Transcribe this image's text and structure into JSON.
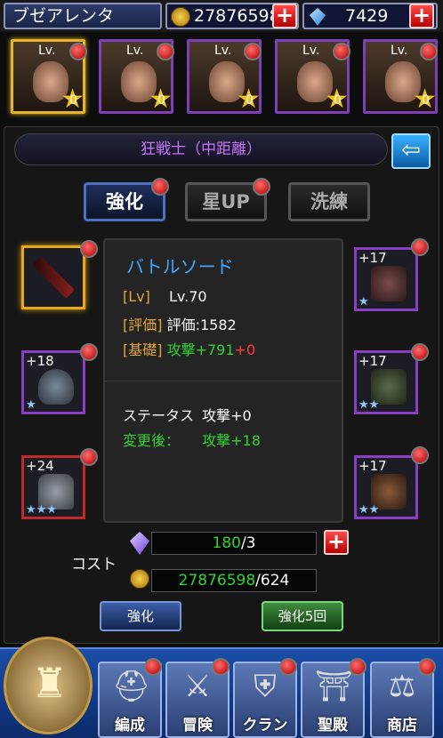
{
  "topbar": {
    "player_name": "ブゼアレンタ",
    "gold": "27876598",
    "gems": "7429",
    "add_gold_label": "+",
    "add_gems_label": "+"
  },
  "heroes": [
    {
      "lv": "Lv.",
      "count": "0",
      "selected": true
    },
    {
      "lv": "Lv.",
      "count": "0",
      "selected": false
    },
    {
      "lv": "Lv.",
      "count": "0",
      "selected": false
    },
    {
      "lv": "Lv.",
      "count": "0",
      "selected": false
    },
    {
      "lv": "Lv.",
      "count": "0",
      "selected": false
    }
  ],
  "class_name": "狂戦士（中距離）",
  "tabs": [
    "強化",
    "星UP",
    "洗練"
  ],
  "equipment": {
    "left": [
      {
        "plus": "",
        "stars": "",
        "border": "gold"
      },
      {
        "plus": "+18",
        "stars": "★",
        "border": "purple"
      },
      {
        "plus": "+24",
        "stars": "★★★",
        "border": "red"
      }
    ],
    "right": [
      {
        "plus": "+17",
        "stars": "★",
        "border": "purple"
      },
      {
        "plus": "+17",
        "stars": "★★",
        "border": "purple"
      },
      {
        "plus": "+17",
        "stars": "★★",
        "border": "purple"
      }
    ]
  },
  "item": {
    "name": "バトルソード",
    "lv_label": "[Lv]",
    "lv_value": "Lv.70",
    "eval_label": "[評価]",
    "eval_value": "評価:1582",
    "base_label": "[基礎]",
    "base_value": "攻撃+791",
    "base_bonus": "+0",
    "status_label": "ステータス",
    "status_value": "攻撃+0",
    "after_label": "変更後：",
    "after_value": "攻撃+18"
  },
  "cost": {
    "label": "コスト",
    "crystal_have": "180",
    "crystal_need": "/3",
    "gold_have": "27876598",
    "gold_need": "/624"
  },
  "buttons": {
    "enhance": "強化",
    "enhance5": "強化5回"
  },
  "nav": [
    "編成",
    "冒険",
    "クラン",
    "聖殿",
    "商店"
  ]
}
